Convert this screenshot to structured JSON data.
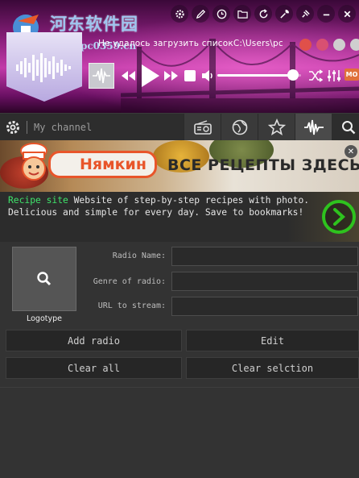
{
  "watermark": {
    "site_name": "河东软件园",
    "url": "www.pc0359.cn"
  },
  "player": {
    "status_text": "Не удалось загрузить списокC:\\Users\\pc",
    "status_dots": [
      "#e0504a",
      "#d85072",
      "#cfcfcf",
      "#cfcfcf"
    ],
    "badge": "MO",
    "volume_percent": 90,
    "accent_color": "#e0703a"
  },
  "toolbar": {
    "icons": [
      "gear-icon",
      "pen-icon",
      "clock-icon",
      "folder-icon",
      "refresh-icon",
      "tools-icon",
      "pin-icon",
      "minimize-icon",
      "close-icon"
    ]
  },
  "channel_bar": {
    "placeholder": "My channel",
    "tabs": [
      "radio-icon",
      "globe-icon",
      "star-icon",
      "waveform-icon"
    ]
  },
  "ad": {
    "brand": "Нямкин",
    "slogan": "ВСЕ РЕЦЕПТЫ ЗДЕСЬ!",
    "site_label": "Recipe site",
    "description": " Website of step-by-step recipes with photo. Delicious and simple for every day. Save to bookmarks!",
    "close_label": "✕"
  },
  "form": {
    "logo_caption": "Logotype",
    "fields": [
      {
        "label": "Radio Name:",
        "value": ""
      },
      {
        "label": "Genre of radio:",
        "value": ""
      },
      {
        "label": "URL to stream:",
        "value": ""
      }
    ],
    "buttons": {
      "add": "Add radio",
      "edit": "Edit",
      "clear_all": "Clear all",
      "clear_selection": "Clear selction"
    }
  }
}
